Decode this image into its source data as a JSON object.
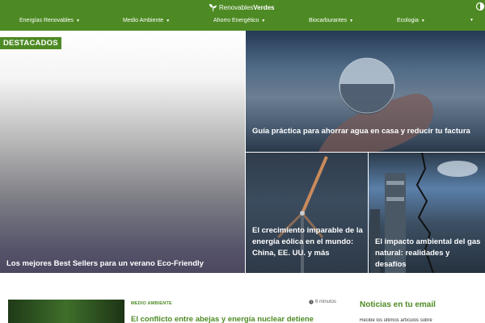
{
  "header": {
    "brand_part1": "Renovables",
    "brand_part2": "Verdes",
    "logo_icon": "leaves-logo-icon",
    "colors": {
      "bar": "#4d8a24",
      "text": "#ffffff"
    }
  },
  "nav": {
    "items": [
      {
        "label": "Energías Renovables"
      },
      {
        "label": "Medio Ambiente"
      },
      {
        "label": "Ahorro Energético"
      },
      {
        "label": "Biocarburantes"
      },
      {
        "label": "Ecologia"
      },
      {
        "label": ""
      }
    ],
    "caret": "▼"
  },
  "featured": {
    "badge": "DESTACADOS",
    "main_title": "Los mejores Best Sellers para un verano Eco-Friendly",
    "cards": [
      {
        "title": "Guía práctica para ahorrar agua en casa y reducir tu factura"
      },
      {
        "title": "El crecimiento imparable de la energía eólica en el mundo: China, EE. UU. y más"
      },
      {
        "title": "El impacto ambiental del gas natural: realidades y desafíos"
      }
    ]
  },
  "latest": {
    "category": "MEDIO AMBIENTE",
    "read_time": "6 minutos",
    "title": "El conflicto entre abejas y energía nuclear detiene"
  },
  "newsletter": {
    "title": "Noticias en tu email",
    "text": "Recibe los últimos artículos sobre"
  }
}
